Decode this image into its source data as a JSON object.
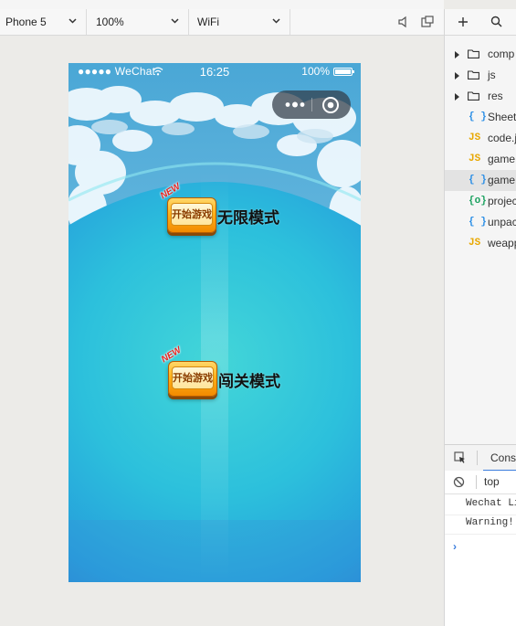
{
  "toolbar": {
    "device": "Phone 5",
    "zoom": "100%",
    "network": "WiFi"
  },
  "phone": {
    "status_bar": {
      "carrier": "●●●●● WeChat",
      "time": "16:25",
      "battery": "100%"
    },
    "buttons": [
      {
        "badge_text": "开始游戏",
        "new_tag": "NEW",
        "label": "无限模式"
      },
      {
        "badge_text": "开始游戏",
        "new_tag": "NEW",
        "label": "闯关模式"
      }
    ]
  },
  "file_tree": {
    "items": [
      {
        "type": "folder",
        "label": "comp"
      },
      {
        "type": "folder",
        "label": "js"
      },
      {
        "type": "folder",
        "label": "res"
      },
      {
        "type": "json",
        "icon": "{ }",
        "label": "Sheet"
      },
      {
        "type": "js",
        "icon": "JS",
        "label": "code.j"
      },
      {
        "type": "js",
        "icon": "JS",
        "label": "game"
      },
      {
        "type": "json",
        "icon": "{ }",
        "label": "game",
        "selected": true
      },
      {
        "type": "cfg",
        "icon": "{o}",
        "label": "projec"
      },
      {
        "type": "json",
        "icon": "{ }",
        "label": "unpac"
      },
      {
        "type": "js",
        "icon": "JS",
        "label": "weapp"
      }
    ]
  },
  "console": {
    "tab_label": "Conso",
    "context": "top",
    "logs": [
      "Wechat Li",
      "Warning!"
    ],
    "prompt": "›"
  },
  "colors": {
    "accent": "#3b7ddd",
    "sea": "#2aa3d8"
  }
}
